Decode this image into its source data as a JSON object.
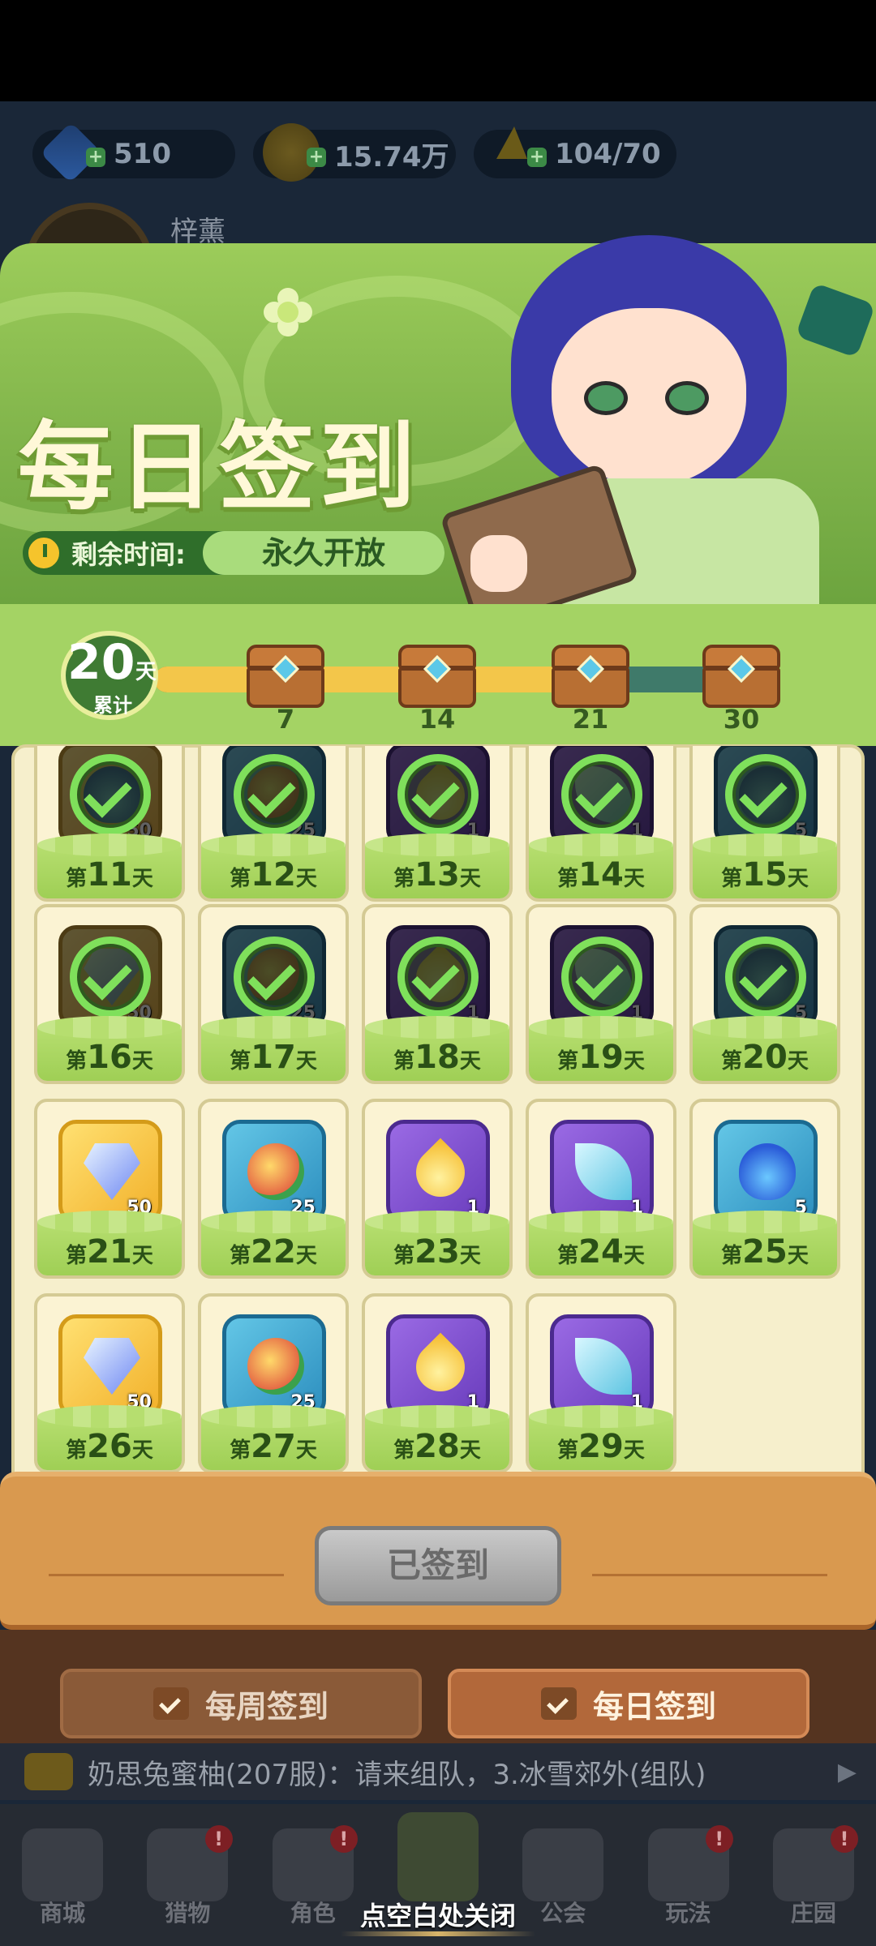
{
  "resources": {
    "gems": "510",
    "coins": "15.74万",
    "energy": "104/70"
  },
  "player": {
    "name": "梓薰"
  },
  "event": {
    "title": "每日签到",
    "remaining_label": "剩余时间:",
    "remaining_value": "永久开放"
  },
  "progress": {
    "days": "20",
    "unit": "天",
    "caption": "累计",
    "fraction": 0.667,
    "milestones": [
      "7",
      "14",
      "21",
      "30"
    ]
  },
  "calendar": {
    "day_prefix": "第",
    "day_suffix": "天",
    "days": [
      {
        "day": "11",
        "item": "potion-gray",
        "qty": "50",
        "signed": true
      },
      {
        "day": "12",
        "item": "orb",
        "qty": "25",
        "signed": true
      },
      {
        "day": "13",
        "item": "drop",
        "qty": "1",
        "signed": true
      },
      {
        "day": "14",
        "item": "leaf",
        "qty": "1",
        "signed": true
      },
      {
        "day": "15",
        "item": "potion",
        "qty": "5",
        "signed": true
      },
      {
        "day": "16",
        "item": "diamond",
        "qty": "50",
        "signed": true
      },
      {
        "day": "17",
        "item": "orb",
        "qty": "25",
        "signed": true
      },
      {
        "day": "18",
        "item": "drop",
        "qty": "1",
        "signed": true
      },
      {
        "day": "19",
        "item": "leaf",
        "qty": "1",
        "signed": true
      },
      {
        "day": "20",
        "item": "potion",
        "qty": "5",
        "signed": true
      },
      {
        "day": "21",
        "item": "diamond",
        "qty": "50",
        "signed": false
      },
      {
        "day": "22",
        "item": "orb",
        "qty": "25",
        "signed": false
      },
      {
        "day": "23",
        "item": "drop",
        "qty": "1",
        "signed": false
      },
      {
        "day": "24",
        "item": "leaf",
        "qty": "1",
        "signed": false
      },
      {
        "day": "25",
        "item": "potion",
        "qty": "5",
        "signed": false
      },
      {
        "day": "26",
        "item": "diamond",
        "qty": "50",
        "signed": false
      },
      {
        "day": "27",
        "item": "orb",
        "qty": "25",
        "signed": false
      },
      {
        "day": "28",
        "item": "drop",
        "qty": "1",
        "signed": false
      },
      {
        "day": "29",
        "item": "leaf",
        "qty": "1",
        "signed": false
      }
    ]
  },
  "signed_button": "已签到",
  "tabs": {
    "weekly": "每周签到",
    "daily": "每日签到"
  },
  "chat": {
    "message": "奶思兔蜜柚(207服)：请来组队，3.冰雪郊外(组队)"
  },
  "bottom_nav": [
    "商城",
    "猎物",
    "角色",
    "",
    "公会",
    "玩法",
    "庄园"
  ],
  "close_hint": "点空白处关闭",
  "colors": {
    "accent_green": "#7fe05b",
    "panel_bg": "#f6efcc",
    "footer_orange": "#d9994f"
  }
}
